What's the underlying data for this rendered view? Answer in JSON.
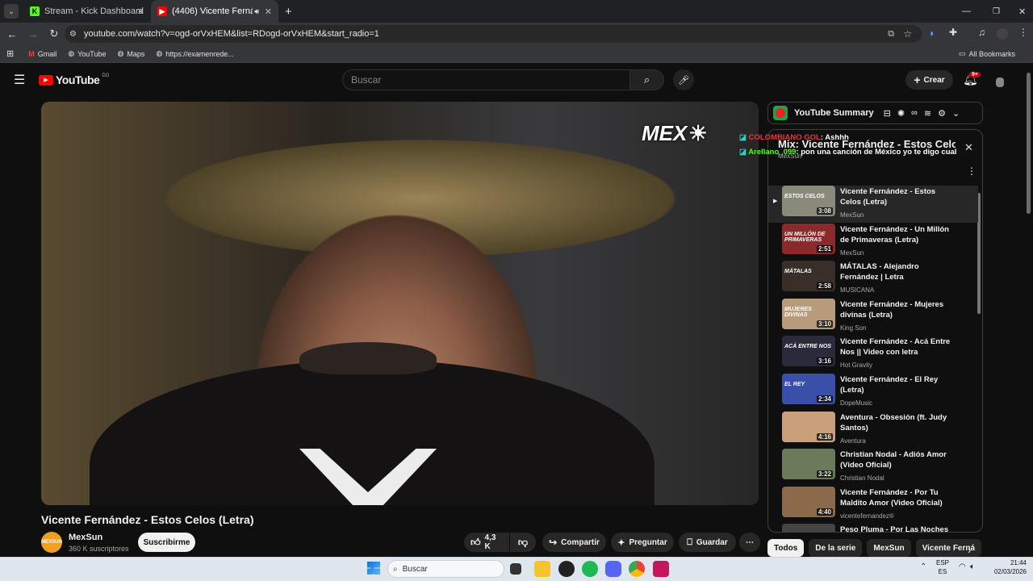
{
  "tabs": [
    {
      "title": "Stream - Kick Dashboard"
    },
    {
      "title": "(4406) Vicente Fernández -"
    }
  ],
  "address": {
    "url": "youtube.com/watch?v=ogd-orVxHEM&list=RDogd-orVxHEM&start_radio=1"
  },
  "bookmarks": {
    "items": [
      "Gmail",
      "YouTube",
      "Maps",
      "https://examenrede..."
    ],
    "all": "All Bookmarks"
  },
  "header": {
    "logo": "YouTube",
    "region": "DO",
    "search_placeholder": "Buscar",
    "create": "Crear",
    "notif_badge": "9+"
  },
  "video": {
    "overlay_logo": "MEX",
    "title": "Vicente Fernández - Estos Celos (Letra)"
  },
  "channel": {
    "avatar": "MEXSUN",
    "name": "MexSun",
    "subs": "360 K suscriptores",
    "subscribe": "Suscribirme"
  },
  "actions": {
    "likes": "4,3 K",
    "share": "Compartir",
    "ask": "Preguntar",
    "save": "Guardar"
  },
  "extension": {
    "name": "YouTube Summary"
  },
  "playlist": {
    "title": "Mix: Vicente Fernández - Estos Celo...",
    "sub": "MexSun"
  },
  "chat": [
    {
      "user": "COLOMBIANO GOL",
      "text": ": Ashhh"
    },
    {
      "user": "Arellano_099",
      "text": ": pon una canción de México yo te digo cual"
    }
  ],
  "queue": [
    {
      "title": "Vicente Fernández - Estos Celos (Letra)",
      "channel": "MexSun",
      "duration": "3:08",
      "thumb": "ESTOS CELOS"
    },
    {
      "title": "Vicente Fernández - Un Millón de Primaveras (Letra)",
      "channel": "MexSun",
      "duration": "2:51",
      "thumb": "UN MILLÓN DE PRIMAVERAS"
    },
    {
      "title": "MÁTALAS - Alejandro Fernández | Letra",
      "channel": "MUSICANA",
      "duration": "2:58",
      "thumb": "MÁTALAS"
    },
    {
      "title": "Vicente Fernández - Mujeres divinas (Letra)",
      "channel": "King Son",
      "duration": "3:10",
      "thumb": "MUJERES DIVINAS"
    },
    {
      "title": "Vicente Fernández - Acá Entre Nos || Video con letra",
      "channel": "Hot Gravity",
      "duration": "3:16",
      "thumb": "ACÁ ENTRE NOS"
    },
    {
      "title": "Vicente Fernández - El Rey (Letra)",
      "channel": "DopeMusic",
      "duration": "2:34",
      "thumb": "EL REY"
    },
    {
      "title": "Aventura - Obsesión (ft. Judy Santos)",
      "channel": "Aventura",
      "duration": "4:16",
      "thumb": ""
    },
    {
      "title": "Christian Nodal - Adiós Amor (Video Oficial)",
      "channel": "Christian Nodal",
      "duration": "3:22",
      "thumb": ""
    },
    {
      "title": "Vicente Fernández - Por Tu Maldito Amor (Video Oficial)",
      "channel": "vicentefernandez®",
      "duration": "4:40",
      "thumb": ""
    },
    {
      "title": "Peso Pluma - Por Las Noches",
      "channel": "",
      "duration": "",
      "thumb": ""
    }
  ],
  "chips": [
    "Todos",
    "De la serie",
    "MexSun",
    "Vicente Ferná"
  ],
  "taskbar": {
    "search": "Buscar",
    "lang1": "ESP",
    "lang2": "ES",
    "time": "21:44",
    "date": "02/03/2026"
  }
}
